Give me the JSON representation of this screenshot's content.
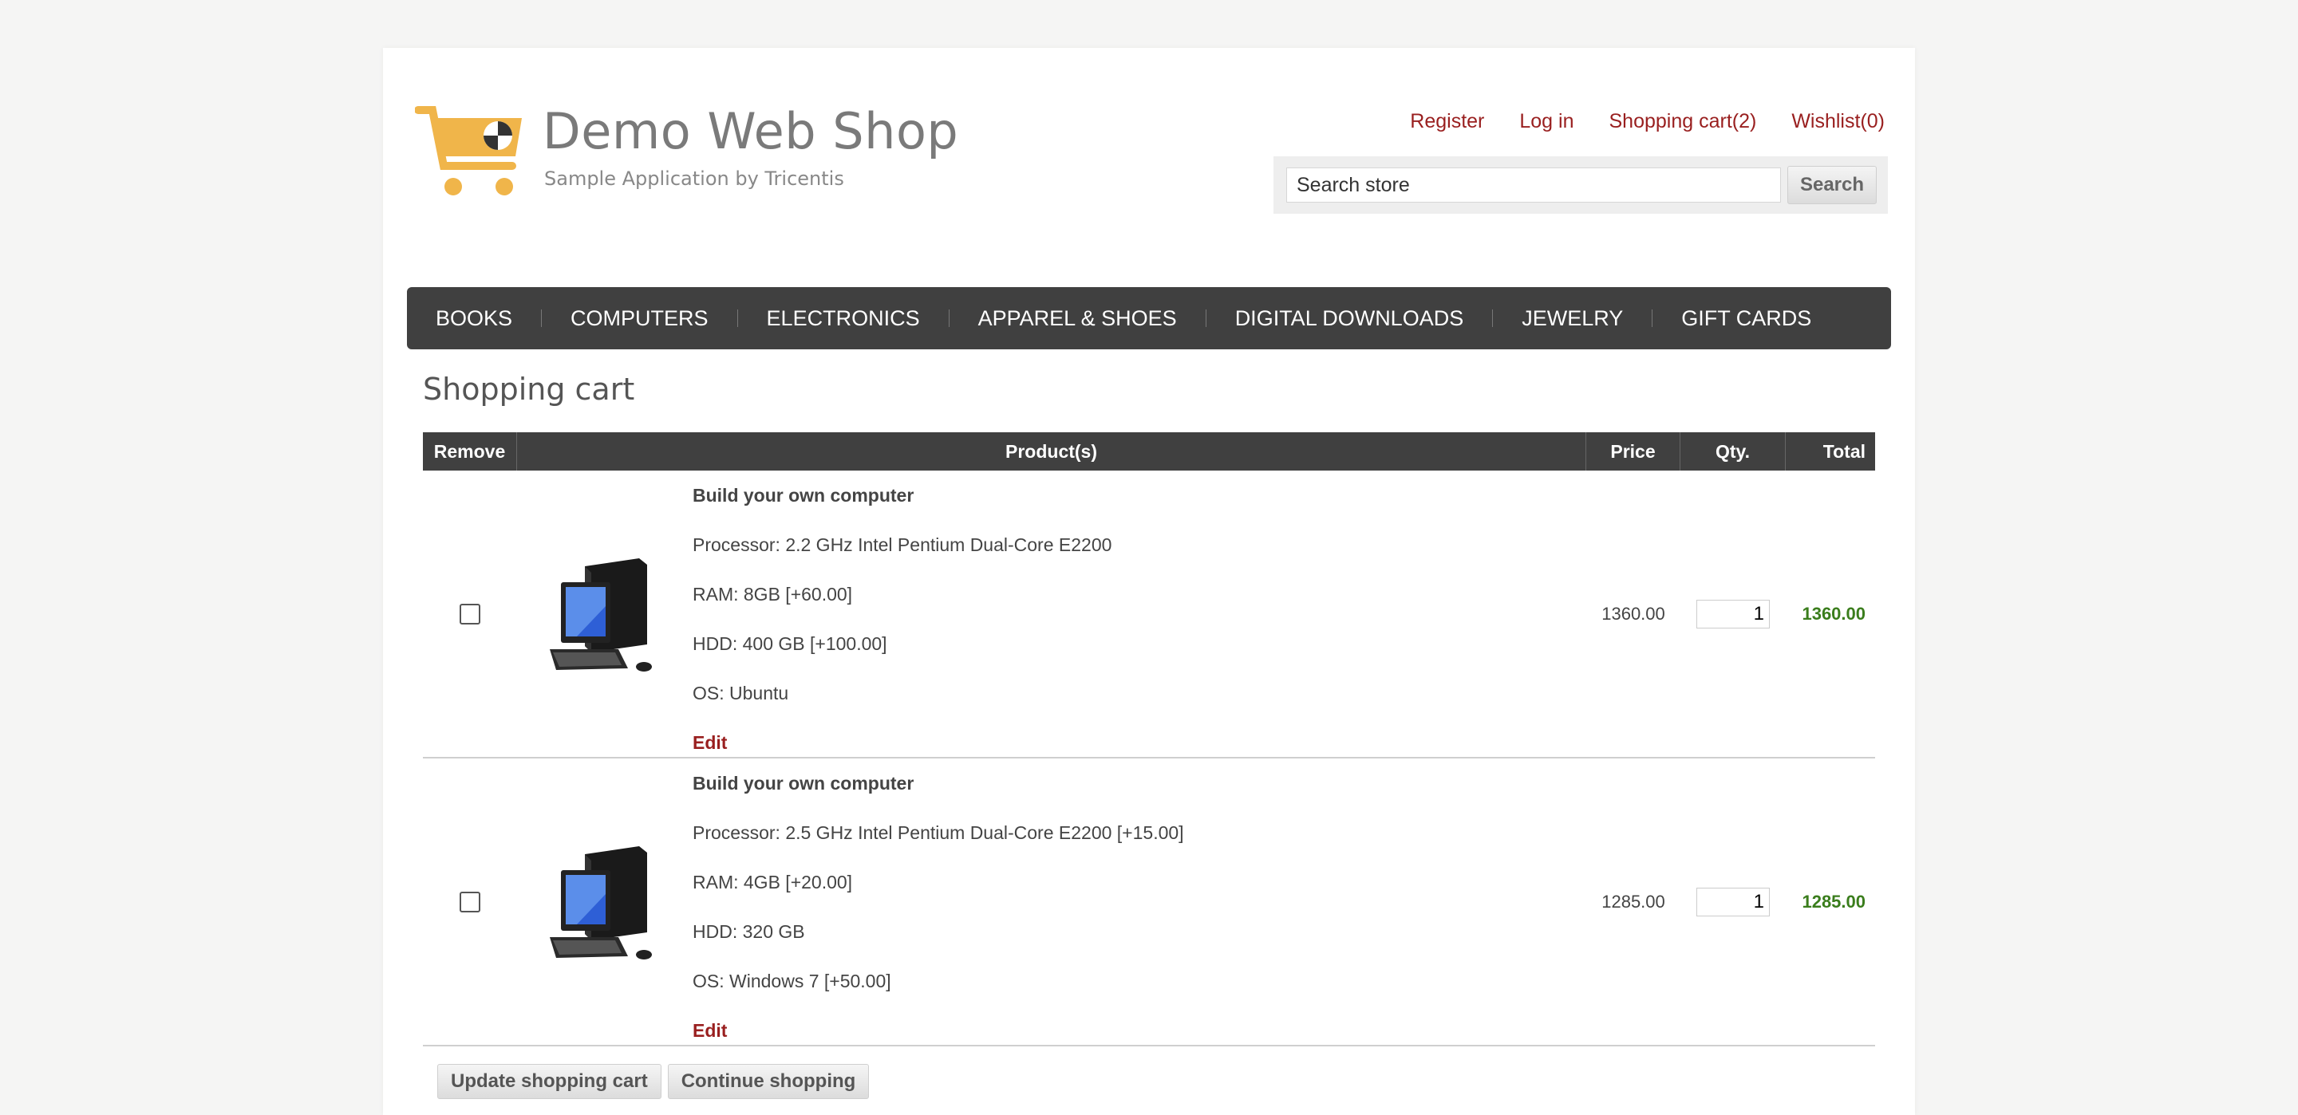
{
  "header": {
    "logo_title": "Demo Web Shop",
    "logo_subtitle": "Sample Application by Tricentis",
    "links": {
      "register": "Register",
      "login": "Log in",
      "cart": "Shopping cart(2)",
      "wishlist": "Wishlist(0)"
    },
    "search": {
      "value": "Search store",
      "button": "Search"
    }
  },
  "nav": [
    "BOOKS",
    "COMPUTERS",
    "ELECTRONICS",
    "APPAREL & SHOES",
    "DIGITAL DOWNLOADS",
    "JEWELRY",
    "GIFT CARDS"
  ],
  "page_title": "Shopping cart",
  "table": {
    "headers": [
      "Remove",
      "Product(s)",
      "Price",
      "Qty.",
      "Total"
    ],
    "rows": [
      {
        "name": "Build your own computer",
        "attrs": [
          "Processor: 2.2 GHz Intel Pentium Dual-Core E2200",
          "RAM: 8GB [+60.00]",
          "HDD: 400 GB [+100.00]",
          "OS: Ubuntu"
        ],
        "edit": "Edit",
        "price": "1360.00",
        "qty": "1",
        "total": "1360.00"
      },
      {
        "name": "Build your own computer",
        "attrs": [
          "Processor: 2.5 GHz Intel Pentium Dual-Core E2200 [+15.00]",
          "RAM: 4GB [+20.00]",
          "HDD: 320 GB",
          "OS: Windows 7 [+50.00]"
        ],
        "edit": "Edit",
        "price": "1285.00",
        "qty": "1",
        "total": "1285.00"
      }
    ]
  },
  "buttons": {
    "update": "Update shopping cart",
    "continue": "Continue shopping"
  },
  "colors": {
    "link": "#991f1f",
    "nav_bg": "#404040",
    "total": "#3a7d1c",
    "logo_cart": "#f0b54a"
  }
}
